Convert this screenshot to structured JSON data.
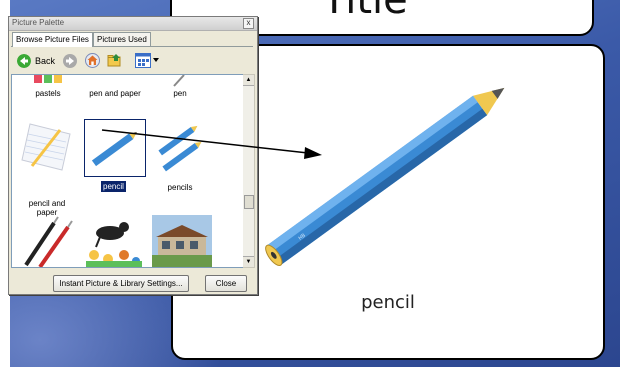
{
  "card_top": {
    "title": "Title"
  },
  "card_main": {
    "caption": "pencil"
  },
  "palette": {
    "window_title": "Picture Palette",
    "close_glyph": "x",
    "tabs": [
      {
        "label": "Browse Picture Files",
        "active": true
      },
      {
        "label": "Pictures Used",
        "active": false
      }
    ],
    "toolbar": {
      "back_label": "Back",
      "icons": [
        "back-arrow-icon",
        "forward-arrow-icon",
        "home-icon",
        "folder-up-icon",
        "view-thumbnails-icon",
        "dropdown-arrow-icon"
      ]
    },
    "top_row_labels": [
      "pastels",
      "pen and paper",
      "pen"
    ],
    "middle_row": [
      {
        "label_line1": "pencil and",
        "label_line2": "paper",
        "selected": false
      },
      {
        "label_line1": "pencil",
        "label_line2": "",
        "selected": true
      },
      {
        "label_line1": "pencils",
        "label_line2": "",
        "selected": false
      }
    ],
    "bottom_row_icons": [
      "pens-icon",
      "dog-flowers-icon",
      "building-photo-icon"
    ],
    "buttons": {
      "settings": "Instant Picture & Library Settings...",
      "close": "Close"
    }
  },
  "colors": {
    "desktop": "#3b5aa8",
    "selection": "#0a246a",
    "pencil_body": "#3a8ad4",
    "pencil_wood": "#f0c850"
  }
}
